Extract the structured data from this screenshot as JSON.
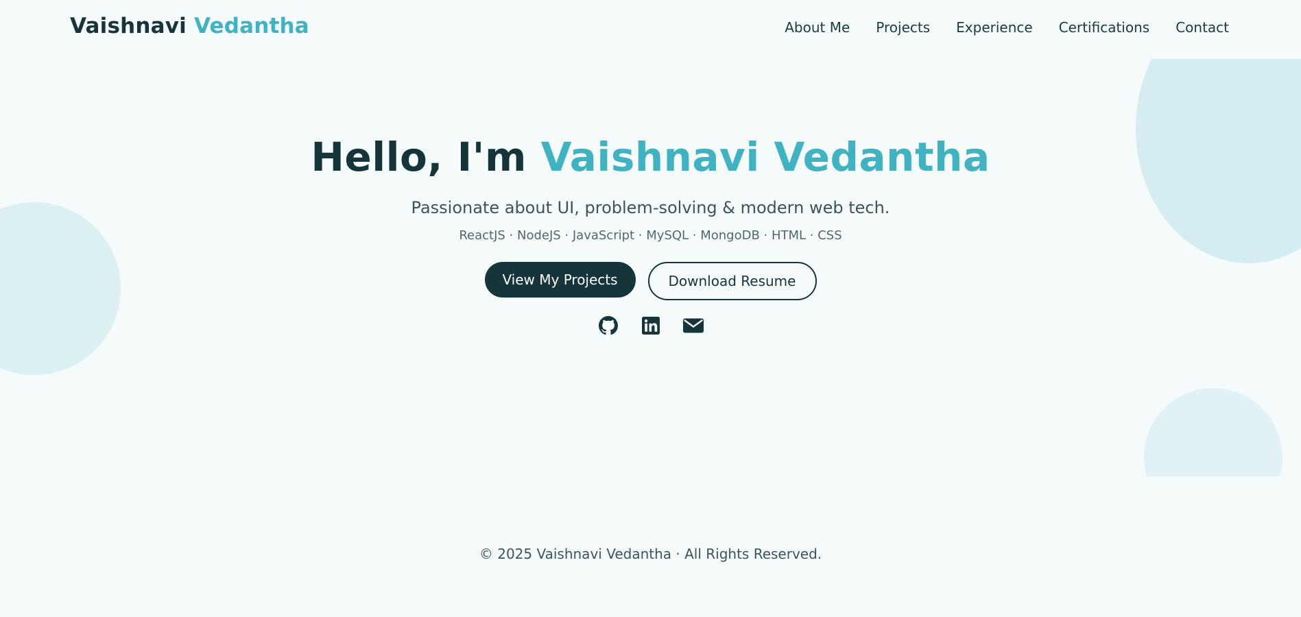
{
  "nav": {
    "brand_first": "Vaishnavi",
    "brand_last": "Vedantha",
    "links": [
      "About Me",
      "Projects",
      "Experience",
      "Certifications",
      "Contact"
    ]
  },
  "hero": {
    "greeting": "Hello, I'm ",
    "name": "Vaishnavi Vedantha",
    "tagline": "Passionate about UI, problem-solving & modern web tech.",
    "skills": "ReactJS · NodeJS · JavaScript · MySQL · MongoDB · HTML · CSS",
    "primary_button": "View My Projects",
    "secondary_button": "Download Resume",
    "social_icons": [
      "github-icon",
      "linkedin-icon",
      "envelope-icon"
    ]
  },
  "footer": {
    "copyright": "© 2025 Vaishnavi Vedantha · All Rights Reserved."
  },
  "colors": {
    "background": "#f5fafb",
    "primary_dark": "#15353a",
    "accent": "#3fb3c2",
    "decor_circle": "#d4edf1"
  }
}
